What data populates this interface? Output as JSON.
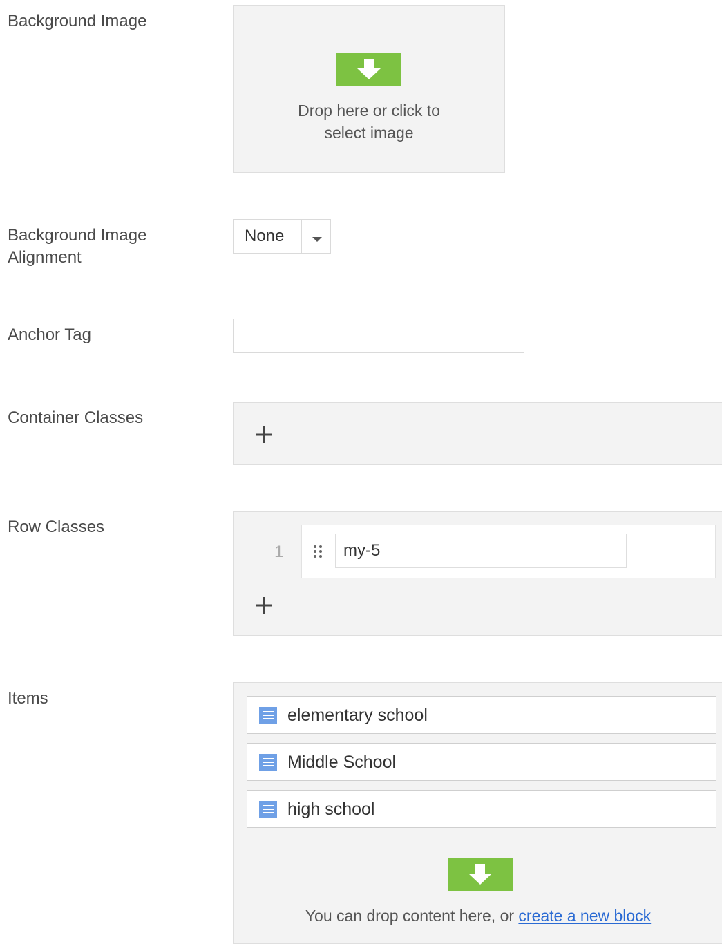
{
  "fields": {
    "background_image": {
      "label": "Background Image",
      "dropzone_line1": "Drop here or click to",
      "dropzone_line2": "select image"
    },
    "background_image_alignment": {
      "label_line1": "Background Image",
      "label_line2": "Alignment",
      "selected": "None"
    },
    "anchor_tag": {
      "label": "Anchor Tag",
      "value": ""
    },
    "container_classes": {
      "label": "Container Classes"
    },
    "row_classes": {
      "label": "Row Classes",
      "rows": [
        {
          "index": "1",
          "value": "my-5"
        }
      ]
    },
    "items": {
      "label": "Items",
      "blocks": [
        {
          "name": "elementary school"
        },
        {
          "name": "Middle School"
        },
        {
          "name": "high school"
        }
      ],
      "drop_text": "You can drop content here, or",
      "create_link": "create a new block"
    }
  },
  "colors": {
    "accent_green": "#7dc242",
    "link_blue": "#2a6ad3",
    "doc_icon_blue": "#6fa0e6"
  },
  "icons": [
    "download-arrow-icon",
    "caret-down-icon",
    "plus-icon",
    "drag-handle-icon",
    "document-icon"
  ]
}
